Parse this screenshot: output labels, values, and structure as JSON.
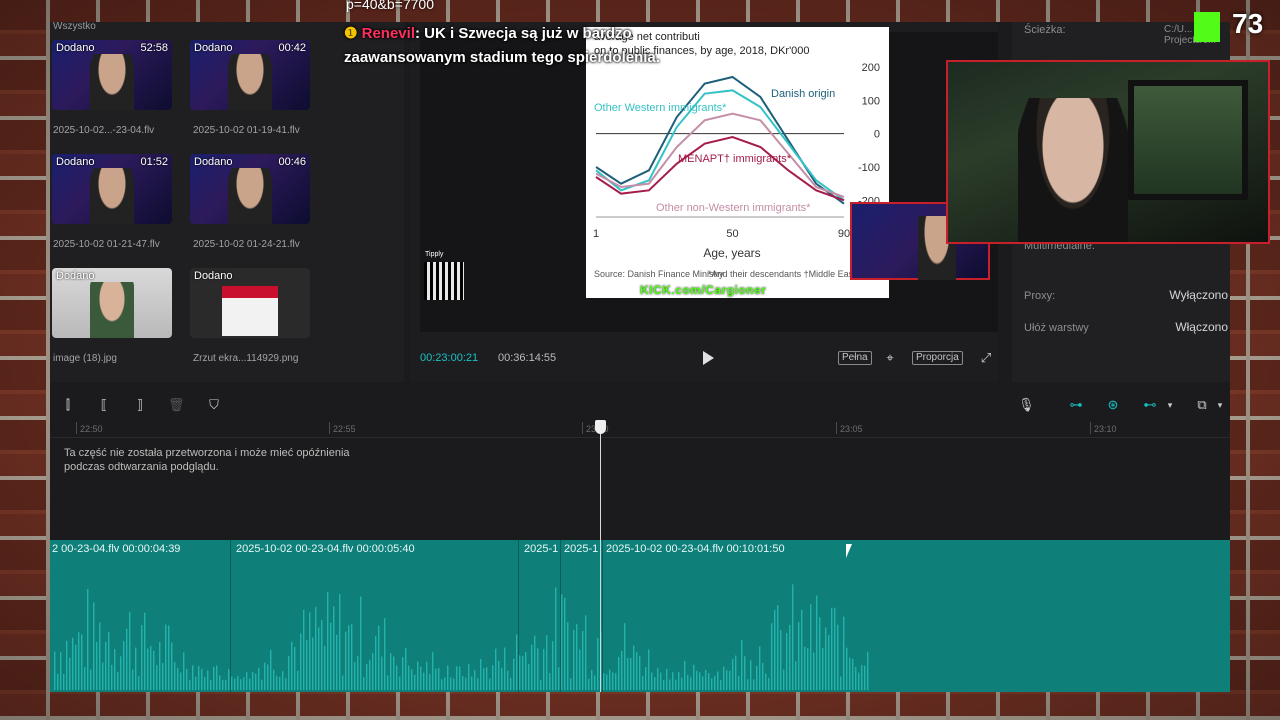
{
  "stream_overlay": {
    "top_text": "p=40&b=7700",
    "chat_user": "Renevil",
    "chat_message": ": UK i Szwecja są już w bardzo zaawansowanym stadium tego spierdolenia.",
    "viewer_count": "73",
    "watermark": "KICK.com/Cargioner",
    "tipply_label": "Tipply"
  },
  "media_library": {
    "tab": "Wszystko",
    "items": [
      {
        "badge": "Dodano",
        "duration": "52:58",
        "name": "2025-10-02...-23-04.flv"
      },
      {
        "badge": "Dodano",
        "duration": "00:42",
        "name": "2025-10-02 01-19-41.flv"
      },
      {
        "badge": "Dodano",
        "duration": "01:52",
        "name": "2025-10-02 01-21-47.flv"
      },
      {
        "badge": "Dodano",
        "duration": "00:46",
        "name": "2025-10-02 01-24-21.flv"
      },
      {
        "badge": "Dodano",
        "duration": "",
        "name": "image (18).jpg"
      },
      {
        "badge": "Dodano",
        "duration": "",
        "name": "Zrzut ekra...114929.png"
      }
    ]
  },
  "preview": {
    "current_time": "00:23:00:21",
    "total_time": "00:36:14:55",
    "btn_full": "Pełna",
    "btn_ratio": "Proporcja"
  },
  "properties": {
    "path_label": "Ścieżka:",
    "path_value": "C:/U... Projects/c...",
    "media_label": "Multimedialne:",
    "proxy_label": "Proxy:",
    "proxy_value": "Wyłączono",
    "layers_label": "Ułóż warstwy",
    "layers_value": "Włączono"
  },
  "timeline": {
    "ruler": [
      "22:50",
      "22:55",
      "23:00",
      "23:05",
      "23:10"
    ],
    "warning": "Ta część nie została przetworzona i może mieć opóźnienia podczas odtwarzania podglądu.",
    "clips": [
      {
        "label": "2 00-23-04.flv  00:00:04:39"
      },
      {
        "label": "2025-10-02 00-23-04.flv  00:00:05:40"
      },
      {
        "label": "2025-1"
      },
      {
        "label": "2025-1"
      },
      {
        "label": "2025-10-02 00-23-04.flv  00:10:01:50"
      }
    ]
  },
  "chart_data": {
    "type": "line",
    "title": "average net contribution to public finances, by age, 2018, DKr'000",
    "xlabel": "Age, years",
    "ylabel": "",
    "xlim": [
      1,
      90
    ],
    "ylim": [
      -250,
      200
    ],
    "x_ticks": [
      "1",
      "50",
      "90"
    ],
    "y_ticks": [
      "200",
      "100",
      "0",
      "-100",
      "-200"
    ],
    "series": [
      {
        "name": "Danish origin",
        "color": "#1e5f7a",
        "x": [
          1,
          10,
          20,
          30,
          40,
          50,
          60,
          70,
          80,
          90
        ],
        "values": [
          -100,
          -150,
          -110,
          50,
          150,
          170,
          110,
          -20,
          -150,
          -210
        ]
      },
      {
        "name": "Other Western immigrants*",
        "color": "#35c2c7",
        "x": [
          1,
          10,
          20,
          30,
          40,
          50,
          60,
          70,
          80,
          90
        ],
        "values": [
          -110,
          -170,
          -140,
          20,
          120,
          130,
          80,
          -30,
          -140,
          -200
        ]
      },
      {
        "name": "Other non-Western immigrants*",
        "color": "#c48ea7",
        "x": [
          1,
          10,
          20,
          30,
          40,
          50,
          60,
          70,
          80,
          90
        ],
        "values": [
          -120,
          -160,
          -150,
          -40,
          40,
          60,
          40,
          -60,
          -160,
          -190
        ]
      },
      {
        "name": "MENAPT† immigrants*",
        "color": "#a51d4d",
        "x": [
          1,
          10,
          20,
          30,
          40,
          50,
          60,
          70,
          80,
          90
        ],
        "values": [
          -130,
          -180,
          -170,
          -90,
          -30,
          -10,
          -40,
          -110,
          -170,
          -200
        ]
      }
    ],
    "source": "Source: Danish Finance Ministry",
    "footnote": "*And their descendants  †Middle East, North Africa, Pakistan and Turkey"
  },
  "colors": {
    "accent": "#17c3c3",
    "track": "#0f7f7a",
    "kick": "#53fc18"
  }
}
